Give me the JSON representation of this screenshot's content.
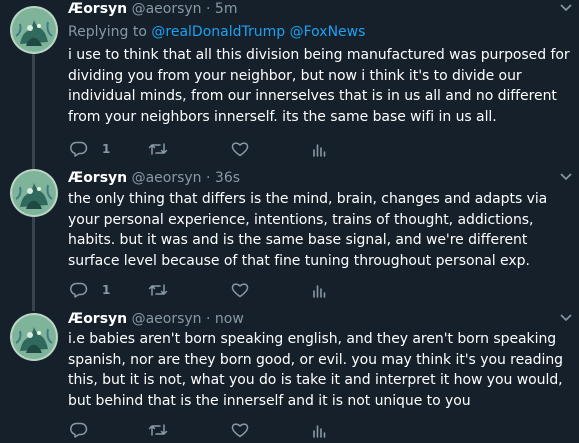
{
  "tweets": [
    {
      "name": "Æorsyn",
      "handle": "@aeorsyn",
      "separator": "·",
      "time": "5m",
      "reply_prefix": "Replying to ",
      "mentions": [
        "@realDonaldTrump",
        "@FoxNews"
      ],
      "lines": [
        "i use to think that all this division being manufactured was purposed for",
        "dividing you from your neighbor, but now i think it's to divide our",
        "individual minds, from our innerselves that is in us all and no different",
        "from your neighbors innerself. its the same base wifi in us all."
      ],
      "reply_count": "1"
    },
    {
      "name": "Æorsyn",
      "handle": "@aeorsyn",
      "separator": "·",
      "time": "36s",
      "lines": [
        "the only thing that differs is the mind, brain, changes and adapts via",
        "your personal experience, intentions, trains of thought, addictions,",
        "habits. but it was and is the same base signal, and we're different",
        "surface level because of that fine tuning throughout personal exp."
      ],
      "reply_count": "1"
    },
    {
      "name": "Æorsyn",
      "handle": "@aeorsyn",
      "separator": "·",
      "time": "now",
      "lines": [
        "i.e babies aren't born speaking english, and they aren't born speaking",
        "spanish, nor are they born good, or evil. you may think it's you reading",
        "this, but it is not, what you do is take it and interpret it how you would,",
        "but behind that is the innerself and it is not unique to you"
      ],
      "reply_count": ""
    }
  ],
  "icons": {
    "reply": "reply-icon",
    "retweet": "retweet-icon",
    "like": "heart-icon",
    "analytics": "analytics-icon",
    "caret": "chevron-down-icon"
  },
  "colors": {
    "background": "#15202b",
    "secondary_text": "#8899a6",
    "link": "#1da1f2",
    "divider": "#38444d"
  }
}
